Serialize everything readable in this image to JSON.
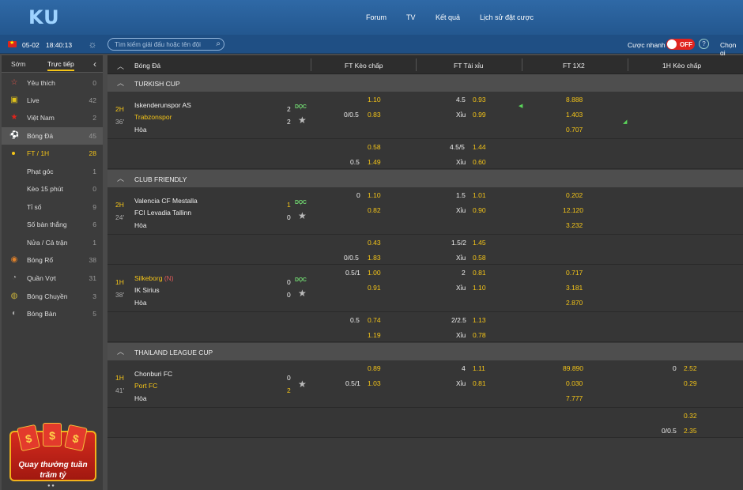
{
  "brand": {
    "logo": "KU"
  },
  "topnav": [
    "Forum",
    "TV",
    "Kết quả",
    "Lịch sử đặt cược"
  ],
  "subbar": {
    "date": "05-02",
    "time": "18:40:13",
    "search_placeholder": "Tìm kiếm giải đấu hoặc tên đội",
    "quick_bet_label": "Cược nhanh",
    "toggle": "OFF",
    "help": "?",
    "choose": "Chọn gi"
  },
  "sidebar": {
    "tabs": [
      "Sớm",
      "Trực tiếp"
    ],
    "items": [
      {
        "label": "Yêu thích",
        "count": "0",
        "icon": "star-icon"
      },
      {
        "label": "Live",
        "count": "42",
        "icon": "tv-icon"
      },
      {
        "label": "Việt Nam",
        "count": "2",
        "icon": "vietnam-flag-icon"
      },
      {
        "label": "Bóng Đá",
        "count": "45",
        "icon": "soccer-ball-icon"
      },
      {
        "label": "FT / 1H",
        "count": "28"
      },
      {
        "label": "Phạt góc",
        "count": "1"
      },
      {
        "label": "Kèo 15 phút",
        "count": "0"
      },
      {
        "label": "Tỉ số",
        "count": "9"
      },
      {
        "label": "Số bàn thắng",
        "count": "6"
      },
      {
        "label": "Nửa / Cả trận",
        "count": "1"
      },
      {
        "label": "Bóng Rổ",
        "count": "38",
        "icon": "basketball-icon"
      },
      {
        "label": "Quần Vợt",
        "count": "31",
        "icon": "tennis-icon"
      },
      {
        "label": "Bóng Chuyền",
        "count": "3",
        "icon": "volleyball-icon"
      },
      {
        "label": "Bóng Bàn",
        "count": "5",
        "icon": "table-tennis-icon"
      }
    ],
    "promo": {
      "line1": "Quay thưởng tuần",
      "line2": "trăm tỷ",
      "coin": "$"
    }
  },
  "columns": {
    "sport": "Bóng Đá",
    "c1": "FT Kèo chấp",
    "c2": "FT Tài xỉu",
    "c3": "FT 1X2",
    "c4": "1H Kèo chấp"
  },
  "labels": {
    "draw": "Hòa",
    "under": "Xỉu",
    "live": "DỌC"
  },
  "leagues": [
    {
      "name": "TURKISH CUP"
    },
    {
      "name": "CLUB FRIENDLY"
    },
    {
      "name": "THAILAND LEAGUE CUP"
    }
  ],
  "matches": [
    {
      "period": "2H",
      "minute": "36'",
      "home": "Iskenderunspor AS",
      "away": "Trabzonspor",
      "score_home": "2",
      "score_away": "2",
      "hdp": "0/0.5",
      "hdp_home": "1.10",
      "hdp_away": "0.83",
      "ou": "4.5",
      "ou_over": "0.93",
      "ou_under": "0.99",
      "x1": "8.888",
      "x2": "1.403",
      "xd": "0.707",
      "alt": {
        "hdp": "0.5",
        "h1": "0.58",
        "h2": "1.49",
        "ou": "4.5/5",
        "o": "1.44",
        "u": "0.60"
      }
    },
    {
      "period": "2H",
      "minute": "24'",
      "home": "Valencia CF Mestalla",
      "away": "FCI Levadia Tallinn",
      "score_home": "1",
      "score_away": "0",
      "hdp": "0",
      "hdp_home": "1.10",
      "hdp_away": "0.82",
      "ou": "1.5",
      "ou_over": "1.01",
      "ou_under": "0.90",
      "x1": "0.202",
      "x2": "12.120",
      "xd": "3.232",
      "alt": {
        "hdp": "0/0.5",
        "h1": "0.43",
        "h2": "1.83",
        "ou": "1.5/2",
        "o": "1.45",
        "u": "0.58"
      }
    },
    {
      "period": "1H",
      "minute": "38'",
      "home": "Silkeborg",
      "home_tag": "(N)",
      "away": "IK Sirius",
      "score_home": "0",
      "score_away": "0",
      "hdp": "0.5/1",
      "hdp_home": "1.00",
      "hdp_away": "0.91",
      "ou": "2",
      "ou_over": "0.81",
      "ou_under": "1.10",
      "x1": "0.717",
      "x2": "3.181",
      "xd": "2.870",
      "alt": {
        "hdp": "0.5",
        "h1": "0.74",
        "h2": "1.19",
        "ou": "2/2.5",
        "o": "1.13",
        "u": "0.78"
      }
    },
    {
      "period": "1H",
      "minute": "41'",
      "home": "Chonburi FC",
      "away": "Port FC",
      "score_home": "0",
      "score_away": "2",
      "hdp": "0.5/1",
      "hdp_home": "0.89",
      "hdp_away": "1.03",
      "ou": "4",
      "ou_over": "1.11",
      "ou_under": "0.81",
      "x1": "89.890",
      "x2": "0.030",
      "xd": "7.777",
      "h1": {
        "hdp": "0",
        "home": "2.52",
        "away": "0.29"
      },
      "alt": {
        "h1hdp": "0/0.5",
        "h1a": "0.32",
        "h1b": "2.35"
      }
    }
  ],
  "colors": {
    "accent": "#f5c518",
    "up": "#5ad65a",
    "down": "#e05a5a",
    "brand": "#2f69a6"
  }
}
